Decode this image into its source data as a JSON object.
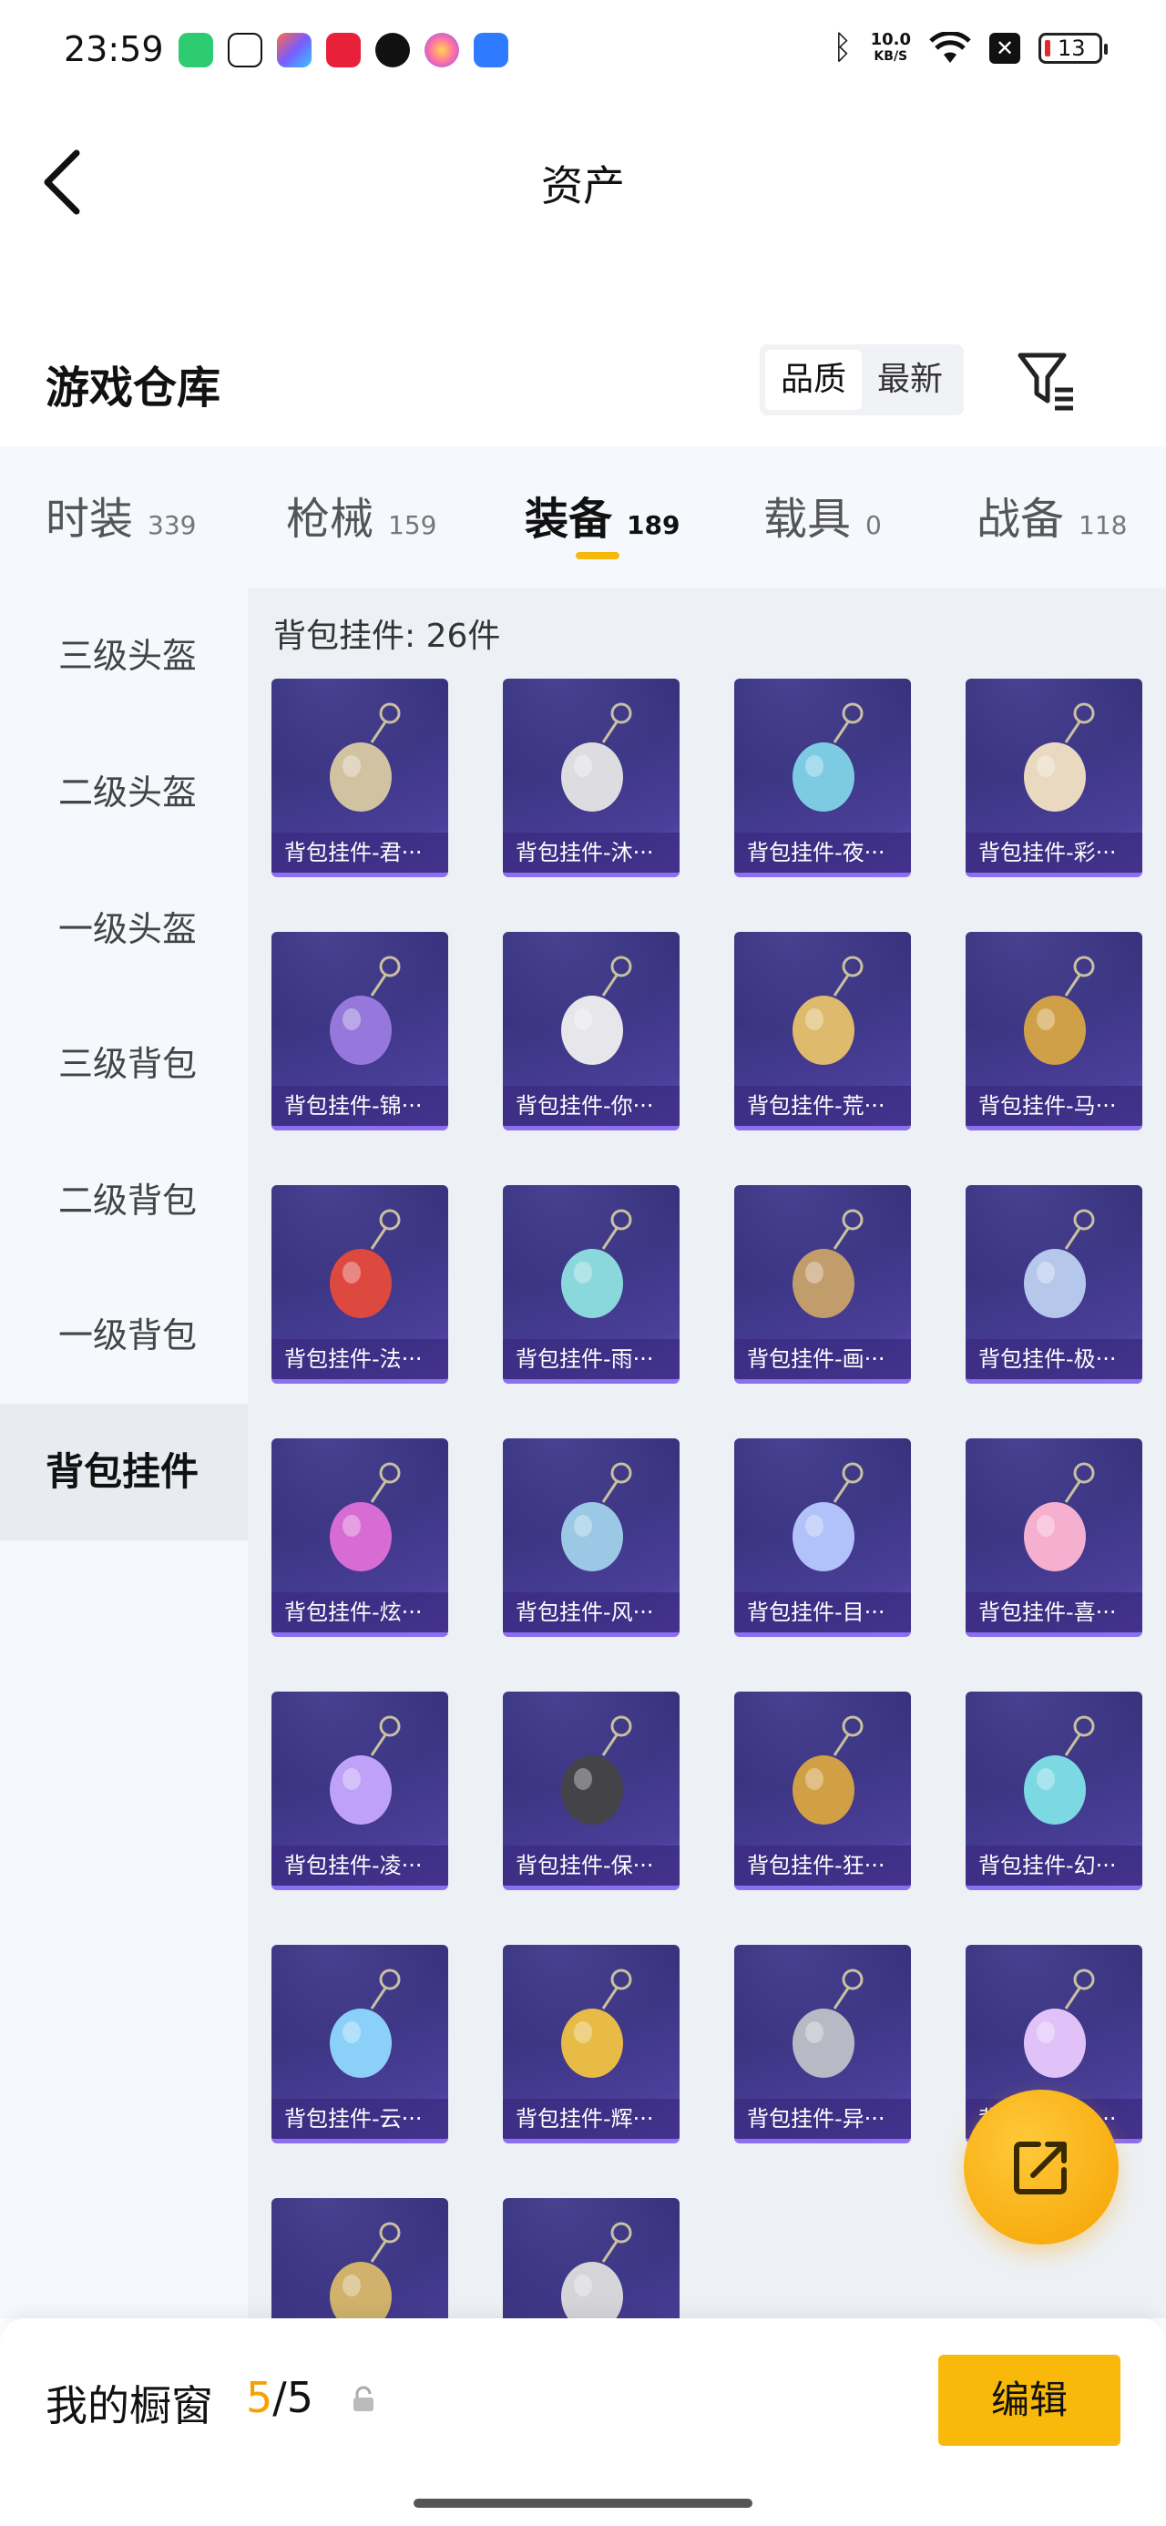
{
  "status_bar": {
    "time": "23:59",
    "apps": [
      {
        "icon": "battery-saver-app-icon",
        "color": "#2ecc71"
      },
      {
        "icon": "wechat-icon",
        "color": "#ffffff"
      },
      {
        "icon": "photos-app-icon",
        "color": "#7b5cff"
      },
      {
        "icon": "music-app-icon",
        "color": "#e8203a"
      },
      {
        "icon": "shield-app-icon",
        "color": "#111111"
      },
      {
        "icon": "flower-app-icon",
        "color": "#ff6fa6"
      },
      {
        "icon": "bluetooth-app-icon",
        "color": "#2f7bff"
      }
    ],
    "speed_value": "10.0",
    "speed_unit": "KB/S",
    "battery": "13"
  },
  "header": {
    "title": "资产"
  },
  "section": {
    "title": "游戏仓库",
    "sort_options": [
      "品质",
      "最新"
    ],
    "sort_selected": "品质"
  },
  "tabs": [
    {
      "name": "时装",
      "count": "339"
    },
    {
      "name": "枪械",
      "count": "159"
    },
    {
      "name": "装备",
      "count": "189"
    },
    {
      "name": "载具",
      "count": "0"
    },
    {
      "name": "战备",
      "count": "118"
    }
  ],
  "active_tab": "装备",
  "sidebar": {
    "items": [
      "三级头盔",
      "二级头盔",
      "一级头盔",
      "三级背包",
      "二级背包",
      "一级背包",
      "背包挂件"
    ],
    "selected": "背包挂件"
  },
  "content": {
    "header": "背包挂件: 26件",
    "items": [
      {
        "name": "背包挂件-君···",
        "icon": "umbrella-charm-icon"
      },
      {
        "name": "背包挂件-沐···",
        "icon": "cat-charm-icon"
      },
      {
        "name": "背包挂件-夜···",
        "icon": "beetle-charm-icon"
      },
      {
        "name": "背包挂件-彩···",
        "icon": "ice-cream-charm-icon"
      },
      {
        "name": "背包挂件-锦···",
        "icon": "fan-charm-icon"
      },
      {
        "name": "背包挂件-你···",
        "icon": "penguin-charm-icon"
      },
      {
        "name": "背包挂件-荒···",
        "icon": "sun-charm-icon"
      },
      {
        "name": "背包挂件-马···",
        "icon": "rocking-horse-charm-icon"
      },
      {
        "name": "背包挂件-法···",
        "icon": "shield-badge-charm-icon"
      },
      {
        "name": "背包挂件-雨···",
        "icon": "wand-charm-icon"
      },
      {
        "name": "背包挂件-画···",
        "icon": "brush-charm-icon"
      },
      {
        "name": "背包挂件-极···",
        "icon": "jar-charm-icon"
      },
      {
        "name": "背包挂件-炫···",
        "icon": "candy-charm-icon"
      },
      {
        "name": "背包挂件-风···",
        "icon": "flag-charm-icon"
      },
      {
        "name": "背包挂件-目···",
        "icon": "ring-charm-icon"
      },
      {
        "name": "背包挂件-喜···",
        "icon": "bow-charm-icon"
      },
      {
        "name": "背包挂件-凌···",
        "icon": "swirl-charm-icon"
      },
      {
        "name": "背包挂件-保···",
        "icon": "car-key-charm-icon"
      },
      {
        "name": "背包挂件-狂···",
        "icon": "claw-charm-icon"
      },
      {
        "name": "背包挂件-幻···",
        "icon": "robot-charm-icon"
      },
      {
        "name": "背包挂件-云···",
        "icon": "snowman-charm-icon"
      },
      {
        "name": "背包挂件-辉···",
        "icon": "feather-charm-icon"
      },
      {
        "name": "背包挂件-异···",
        "icon": "wing-badge-charm-icon"
      },
      {
        "name": "背包挂件-幻···",
        "icon": "star-charm-icon"
      },
      {
        "name": "",
        "icon": "plane-charm-icon"
      },
      {
        "name": "",
        "icon": "bell-charm-icon"
      }
    ]
  },
  "showcase": {
    "label": "我的橱窗",
    "current": "5",
    "separator": "/",
    "total": "5",
    "edit_label": "编辑"
  },
  "colors": {
    "accent": "#f5a201",
    "edit_button": "#f8b90b",
    "card_bg": "#3b3582",
    "card_border": "#8c6ef0"
  }
}
